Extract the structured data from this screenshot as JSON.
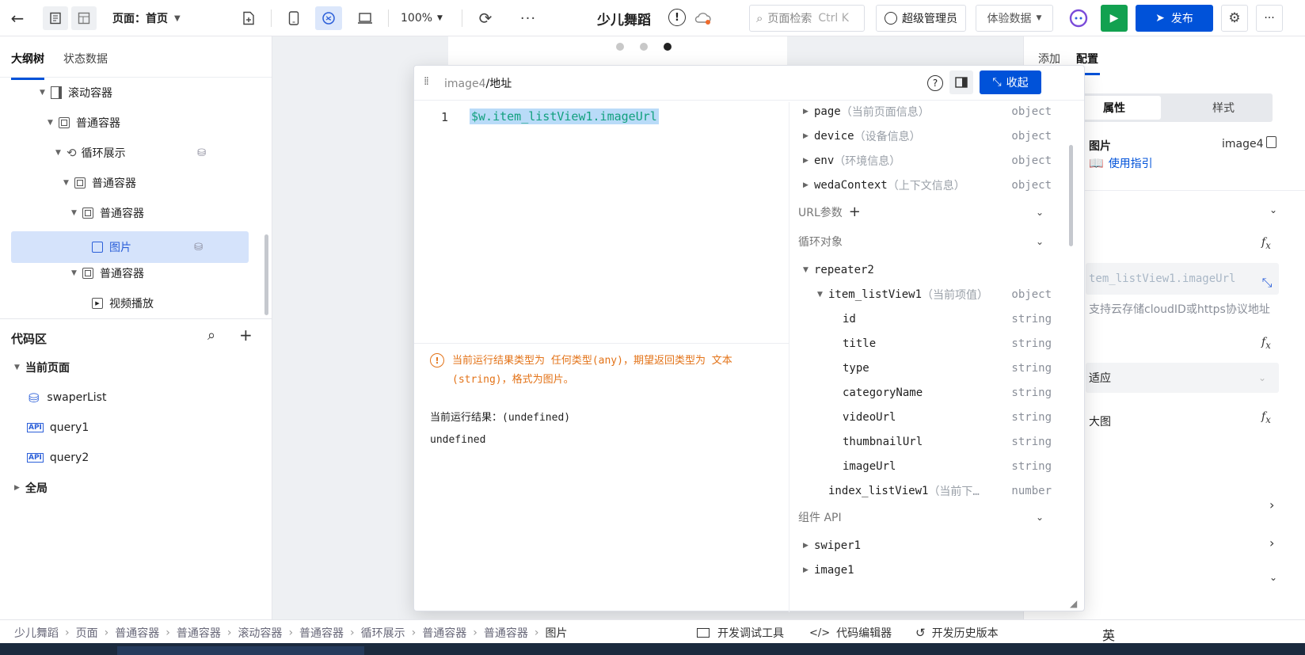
{
  "topbar": {
    "page_label": "页面：首页",
    "zoom": "100%",
    "app_title": "少儿舞蹈",
    "search_placeholder": "页面检索",
    "search_shortcut": "Ctrl K",
    "admin_label": "超级管理员",
    "data_select": "体验数据",
    "publish_label": "发布"
  },
  "left": {
    "tabs": [
      "大纲树",
      "状态数据"
    ],
    "tree": [
      {
        "label": "滚动容器",
        "icon": "scroll-container-icon"
      },
      {
        "label": "普通容器",
        "icon": "container-icon"
      },
      {
        "label": "循环展示",
        "icon": "loop-icon"
      },
      {
        "label": "普通容器",
        "icon": "container-icon"
      },
      {
        "label": "普通容器",
        "icon": "container-icon"
      },
      {
        "label": "图片",
        "icon": "image-icon"
      },
      {
        "label": "普通容器",
        "icon": "container-icon"
      },
      {
        "label": "视频播放",
        "icon": "video-icon"
      }
    ],
    "code_title": "代码区",
    "current_page": "当前页面",
    "code_items": [
      {
        "label": "swaperList",
        "icon": "database-icon"
      },
      {
        "label": "query1",
        "icon": "api-icon"
      },
      {
        "label": "query2",
        "icon": "api-icon"
      }
    ],
    "global": "全局"
  },
  "editor": {
    "breadcrumb_prefix": "image4",
    "breadcrumb_suffix": "/地址",
    "collapse_label": "收起",
    "line_no": "1",
    "code": "$w.item_listView1.imageUrl",
    "warning": "当前运行结果类型为 任何类型(any)，期望返回类型为 文本(string)，格式为图片。",
    "result_label": "当前运行结果：(undefined)",
    "result_value": "undefined",
    "vars_top": [
      {
        "name": "page",
        "desc": "（当前页面信息）",
        "type": "object"
      },
      {
        "name": "device",
        "desc": "（设备信息）",
        "type": "object"
      },
      {
        "name": "env",
        "desc": "（环境信息）",
        "type": "object"
      },
      {
        "name": "wedaContext",
        "desc": "（上下文信息）",
        "type": "object"
      }
    ],
    "url_params": "URL参数",
    "loop_obj": "循环对象",
    "repeater": "repeater2",
    "item_name": "item_listView1",
    "item_desc": "（当前项值）",
    "item_type": "object",
    "fields": [
      {
        "name": "id",
        "type": "string"
      },
      {
        "name": "title",
        "type": "string"
      },
      {
        "name": "type",
        "type": "string"
      },
      {
        "name": "categoryName",
        "type": "string"
      },
      {
        "name": "videoUrl",
        "type": "string"
      },
      {
        "name": "thumbnailUrl",
        "type": "string"
      },
      {
        "name": "imageUrl",
        "type": "string"
      }
    ],
    "index_name": "index_listView1",
    "index_desc": "（当前下…",
    "index_type": "number",
    "component_api": "组件 API",
    "components": [
      "swiper1",
      "image1"
    ]
  },
  "right": {
    "tabs": [
      "添加",
      "配置"
    ],
    "subtabs": [
      "属性",
      "样式"
    ],
    "comp_name": "图片",
    "comp_id": "image4",
    "guide": "使用指引",
    "fx_value": "tem_listView1.imageUrl",
    "hint": "支持云存储cloudID或https协议地址",
    "fit": "适应",
    "bigimg": "大图"
  },
  "statusbar": {
    "crumbs": [
      "少儿舞蹈",
      "页面",
      "普通容器",
      "普通容器",
      "滚动容器",
      "普通容器",
      "循环展示",
      "普通容器",
      "普通容器",
      "图片"
    ],
    "dev_tools": "开发调试工具",
    "code_editor": "代码编辑器",
    "history": "开发历史版本",
    "ime": "英"
  },
  "colors": {
    "primary": "#0052d9",
    "run": "#12a150",
    "warning": "#e37318",
    "highlight": "#b9dbf8"
  }
}
